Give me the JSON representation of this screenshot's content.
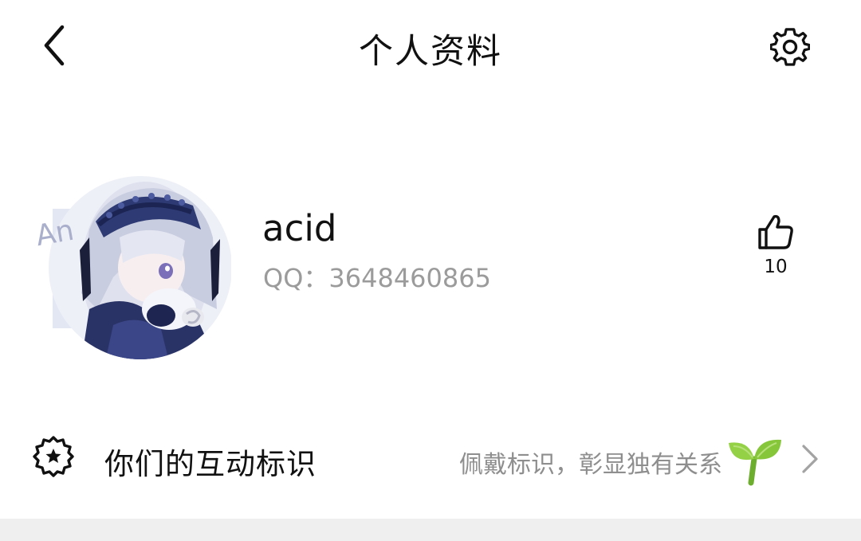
{
  "header": {
    "title": "个人资料",
    "back_icon": "chevron-left-icon",
    "settings_icon": "gear-icon"
  },
  "profile": {
    "nickname": "acid",
    "qq_line": "QQ：3648460865",
    "likes": "10",
    "avatar_text": "An"
  },
  "interaction_badge": {
    "label": "你们的互动标识",
    "hint": "佩戴标识，彰显独有关系",
    "badge_icon": "sprout-icon"
  },
  "colors": {
    "text_primary": "#111111",
    "text_secondary": "#9b9b9b",
    "bottom_band": "#efefef",
    "sprout_green": "#8fcb3e"
  }
}
